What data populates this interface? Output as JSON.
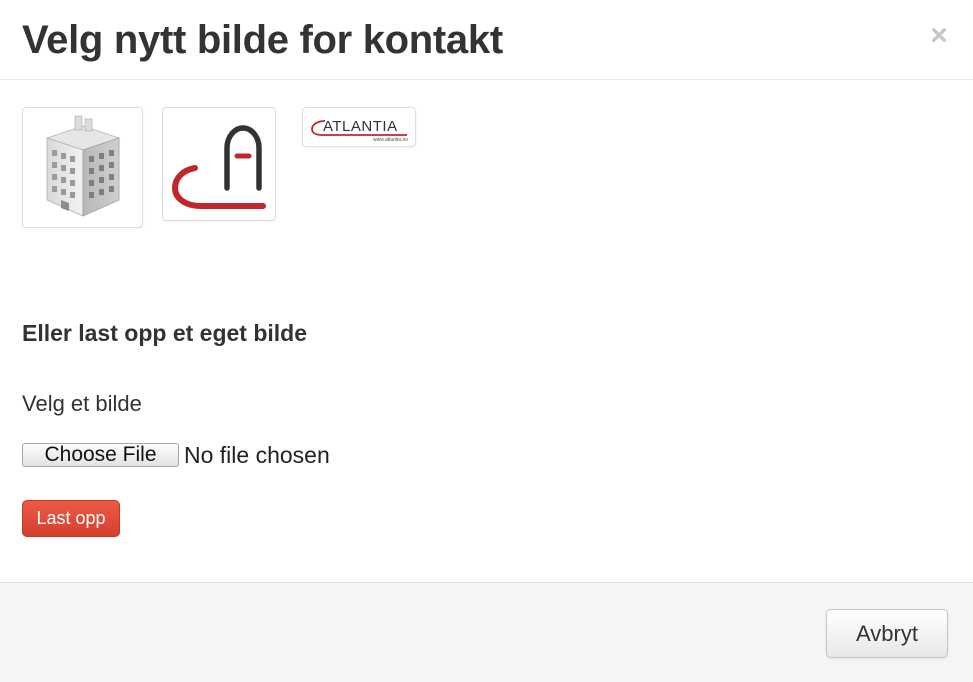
{
  "dialog": {
    "title": "Velg nytt bilde for kontakt",
    "close_label": "×"
  },
  "thumbnails": [
    {
      "icon": "building-icon"
    },
    {
      "icon": "ca-logo-icon"
    },
    {
      "icon": "atlantia-logo-icon",
      "logo_text": "ATLANTIA",
      "logo_url": "www.atlantia.no"
    }
  ],
  "upload": {
    "heading": "Eller last opp et eget bilde",
    "field_label": "Velg et bilde",
    "choose_file_label": "Choose File",
    "file_status": "No file chosen",
    "submit_label": "Last opp"
  },
  "footer": {
    "cancel_label": "Avbryt"
  },
  "colors": {
    "accent_red": "#d4402e",
    "logo_red": "#c0272d"
  }
}
